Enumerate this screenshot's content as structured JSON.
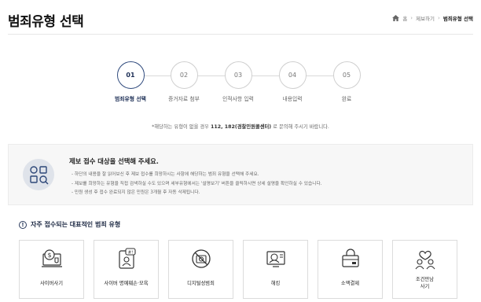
{
  "header": {
    "title": "범죄유형 선택",
    "breadcrumb": [
      "홈",
      "제보하기",
      "범죄유형 선택"
    ]
  },
  "steps": [
    {
      "num": "01",
      "label": "범죄유형 선택",
      "active": true
    },
    {
      "num": "02",
      "label": "증거자료 첨부",
      "active": false
    },
    {
      "num": "03",
      "label": "인적사항 입력",
      "active": false
    },
    {
      "num": "04",
      "label": "내용입력",
      "active": false
    },
    {
      "num": "05",
      "label": "완료",
      "active": false
    }
  ],
  "notice": {
    "prefix": "*해당하는 유형이 없을 경우 ",
    "bold": "112, 182(경찰민원콜센터)",
    "suffix": " 로 문의해 주시기 바랍니다."
  },
  "info": {
    "heading": "제보 접수 대상을 선택해 주세요.",
    "items": [
      "하단의 내용을 잘 읽어보신 후 제보 접수를 희망하시는 사항에 해당하는 범죄 유형을 선택해 주세요.",
      "제보를 희망하는 유형을 직접 검색하실 수도 있으며 세부유형에서는 '설명보기' 버튼을 클릭하시면 상세 설명을 확인하실 수 있습니다.",
      "민원 생성 후 접수 완료되지 않은 민원은 3개월 후 자동 삭제됩니다."
    ]
  },
  "popular": {
    "title": "자주 접수되는 대표적인 범죄 유형",
    "cards": [
      {
        "label": "사이버사기",
        "icon": "cyber-fraud-icon"
      },
      {
        "label": "사이버 명예훼손·모욕",
        "icon": "cyber-defamation-icon"
      },
      {
        "label": "디지털성범죄",
        "icon": "digital-sex-crime-icon"
      },
      {
        "label": "해킹",
        "icon": "hacking-icon"
      },
      {
        "label": "소액결제",
        "icon": "micropayment-icon"
      },
      {
        "label": "조건만남",
        "label2": "사기",
        "icon": "dating-scam-icon"
      }
    ]
  }
}
